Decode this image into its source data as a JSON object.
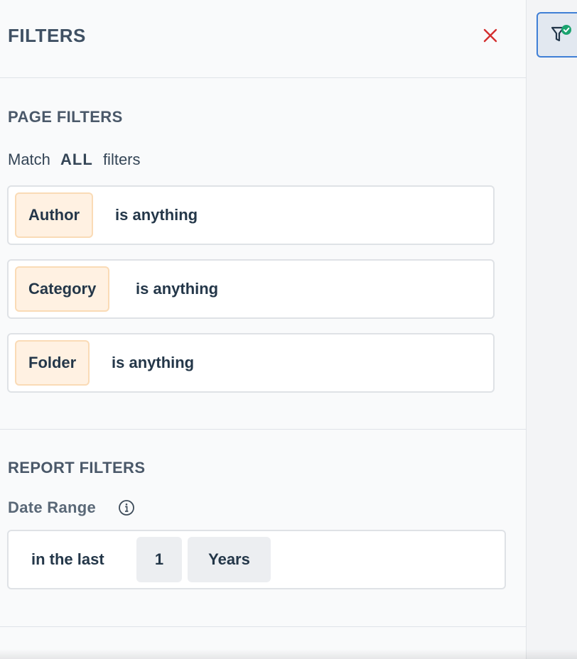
{
  "header": {
    "title": "FILTERS"
  },
  "page_filters": {
    "title": "PAGE FILTERS",
    "match_prefix": "Match",
    "match_mode": "ALL",
    "match_suffix": "filters",
    "filters": [
      {
        "field": "Author",
        "condition": "is anything"
      },
      {
        "field": "Category",
        "condition": "is anything"
      },
      {
        "field": "Folder",
        "condition": "is anything"
      }
    ]
  },
  "report_filters": {
    "title": "REPORT FILTERS",
    "date_range": {
      "label": "Date Range",
      "prefix": "in the last",
      "amount": "1",
      "unit": "Years"
    }
  },
  "icons": {
    "close": "close-icon",
    "info": "info-icon",
    "filter_active": "filter-check-icon"
  },
  "colors": {
    "close": "#d32f2f",
    "chip_bg": "#fff1e2",
    "chip_border": "#fadbb6",
    "active_border": "#3f7fd6",
    "check_badge": "#1aa36f"
  }
}
